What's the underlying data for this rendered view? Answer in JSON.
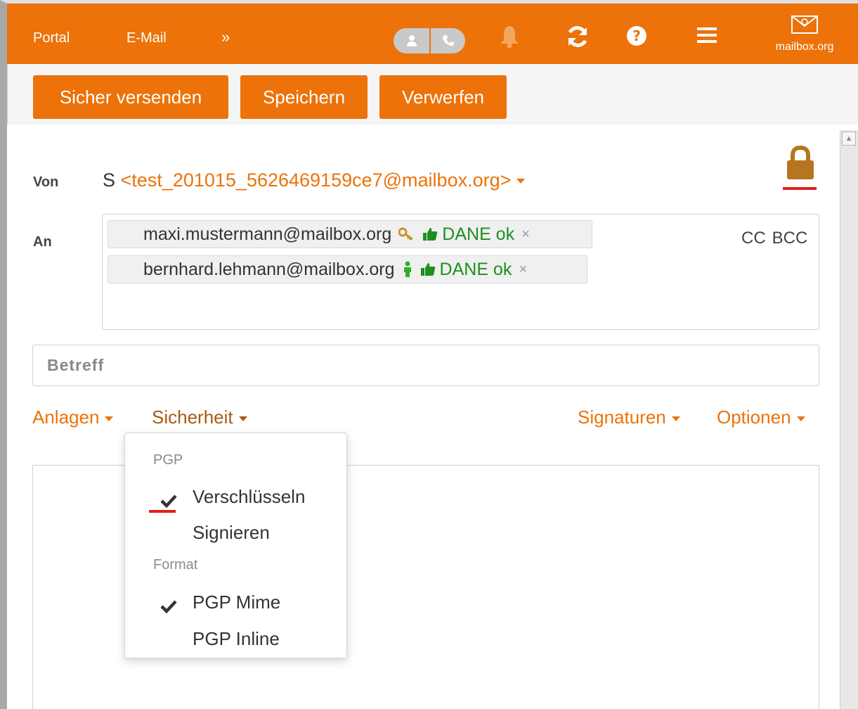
{
  "topbar": {
    "nav": [
      "Portal",
      "E-Mail",
      "»"
    ],
    "brand": "mailbox.org",
    "bg_color": "#ec7209",
    "icons": [
      "person-icon",
      "phone-icon",
      "bell-icon",
      "refresh-icon",
      "help-icon",
      "hamburger-menu-icon",
      "mailbox-logo-icon"
    ]
  },
  "toolbar": {
    "send_label": "Sicher versenden",
    "save_label": "Speichern",
    "discard_label": "Verwerfen"
  },
  "compose": {
    "from_label": "Von",
    "from_name": "S",
    "from_address": "<test_201015_5626469159ce7@mailbox.org>",
    "to_label": "An",
    "recipients": [
      {
        "email": "maxi.mustermann@mailbox.org",
        "key_icon": "key-icon",
        "dane": "DANE ok",
        "remove": "×"
      },
      {
        "email": "bernhard.lehmann@mailbox.org",
        "key_icon": "person-green-icon",
        "dane": "DANE ok",
        "remove": "×"
      }
    ],
    "cc_label": "CC",
    "bcc_label": "BCC",
    "subject_placeholder": "Betreff",
    "links": {
      "attachments": "Anlagen",
      "security": "Sicherheit",
      "signatures": "Signaturen",
      "options": "Optionen"
    }
  },
  "security_menu": {
    "pgp_header": "PGP",
    "encrypt": "Verschlüsseln",
    "encrypt_checked": true,
    "sign": "Signieren",
    "sign_checked": false,
    "format_header": "Format",
    "mime": "PGP Mime",
    "mime_checked": true,
    "inline": "PGP Inline",
    "inline_checked": false
  },
  "colors": {
    "accent": "#ec7209",
    "dane_green": "#1d8f1d",
    "highlight_red": "#e41d1d",
    "lock_brown": "#b5761f"
  }
}
